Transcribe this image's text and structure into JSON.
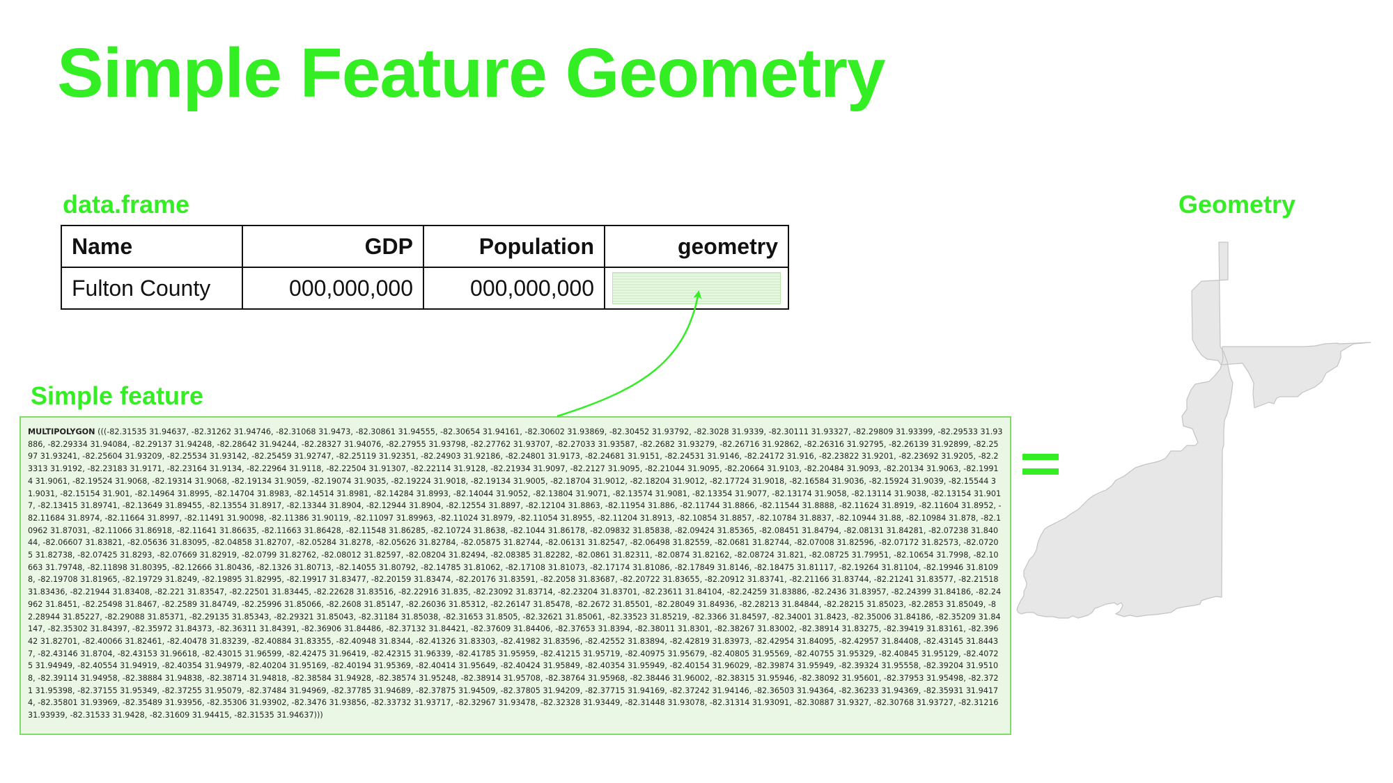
{
  "title": "Simple Feature Geometry",
  "dataframe": {
    "label": "data.frame",
    "headers": [
      "Name",
      "GDP",
      "Population",
      "geometry"
    ],
    "row": [
      "Fulton County",
      "000,000,000",
      "000,000,000"
    ]
  },
  "simple_feature": {
    "label": "Simple feature",
    "keyword": "MULTIPOLYGON",
    "text": " (((-82.31535 31.94637, -82.31262 31.94746, -82.31068 31.9473, -82.30861 31.94555, -82.30654 31.94161, -82.30602 31.93869, -82.30452 31.93792, -82.3028 31.9339, -82.30111 31.93327, -82.29809 31.93399, -82.29533 31.93886, -82.29334 31.94084, -82.29137 31.94248, -82.28642 31.94244, -82.28327 31.94076, -82.27955 31.93798, -82.27762 31.93707, -82.27033 31.93587, -82.2682 31.93279, -82.26716 31.92862, -82.26316 31.92795, -82.26139 31.92899, -82.2597 31.93241, -82.25604 31.93209, -82.25534 31.93142, -82.25459 31.92747, -82.25119 31.92351, -82.24903 31.92186, -82.24801 31.9173, -82.24681 31.9151, -82.24531 31.9146, -82.24172 31.916, -82.23822 31.9201, -82.23692 31.9205, -82.23313 31.9192, -82.23183 31.9171, -82.23164 31.9134, -82.22964 31.9118, -82.22504 31.91307, -82.22114 31.9128, -82.21934 31.9097, -82.2127 31.9095, -82.21044 31.9095, -82.20664 31.9103, -82.20484 31.9093, -82.20134 31.9063, -82.19914 31.9061, -82.19524 31.9068, -82.19314 31.9068, -82.19134 31.9059, -82.19074 31.9035, -82.19224 31.9018, -82.19134 31.9005, -82.18704 31.9012, -82.18204 31.9012, -82.17724 31.9018, -82.16584 31.9036, -82.15924 31.9039, -82.15544 31.9031, -82.15154 31.901, -82.14964 31.8995, -82.14704 31.8983, -82.14514 31.8981, -82.14284 31.8993, -82.14044 31.9052, -82.13804 31.9071, -82.13574 31.9081, -82.13354 31.9077, -82.13174 31.9058, -82.13114 31.9038, -82.13154 31.9017, -82.13415 31.89741, -82.13649 31.89455, -82.13554 31.8917, -82.13344 31.8904, -82.12944 31.8904, -82.12554 31.8897, -82.12104 31.8863, -82.11954 31.886, -82.11744 31.8866, -82.11544 31.8888, -82.11624 31.8919, -82.11604 31.8952, -82.11684 31.8974, -82.11664 31.8997, -82.11491 31.90098, -82.11386 31.90119, -82.11097 31.89963, -82.11024 31.8979, -82.11054 31.8955, -82.11204 31.8913, -82.10854 31.8857, -82.10784 31.8837, -82.10944 31.88, -82.10984 31.878, -82.10962 31.87031, -82.11066 31.86918, -82.11641 31.86635, -82.11663 31.86428, -82.11548 31.86285, -82.10724 31.8638, -82.1044 31.86178, -82.09832 31.85838, -82.09424 31.85365, -82.08451 31.84794, -82.08131 31.84281, -82.07238 31.84044, -82.06607 31.83821, -82.05636 31.83095, -82.04858 31.82707, -82.05284 31.8278, -82.05626 31.82784, -82.05875 31.82744, -82.06131 31.82547, -82.06498 31.82559, -82.0681 31.82744, -82.07008 31.82596, -82.07172 31.82573, -82.07205 31.82738, -82.07425 31.8293, -82.07669 31.82919, -82.0799 31.82762, -82.08012 31.82597, -82.08204 31.82494, -82.08385 31.82282, -82.0861 31.82311, -82.0874 31.82162, -82.08724 31.821, -82.08725 31.79951, -82.10654 31.7998, -82.10663 31.79748, -82.11898 31.80395, -82.12666 31.80436, -82.1326 31.80713, -82.14055 31.80792, -82.14785 31.81062, -82.17108 31.81073, -82.17174 31.81086, -82.17849 31.8146, -82.18475 31.81117, -82.19264 31.81104, -82.19946 31.81098, -82.19708 31.81965, -82.19729 31.8249, -82.19895 31.82995, -82.19917 31.83477, -82.20159 31.83474, -82.20176 31.83591, -82.2058 31.83687, -82.20722 31.83655, -82.20912 31.83741, -82.21166 31.83744, -82.21241 31.83577, -82.21518 31.83436, -82.21944 31.83408, -82.221 31.83547, -82.22501 31.83445, -82.22628 31.83516, -82.22916 31.835, -82.23092 31.83714, -82.23204 31.83701, -82.23611 31.84104, -82.24259 31.83886, -82.2436 31.83957, -82.24399 31.84186, -82.24962 31.8451, -82.25498 31.8467, -82.2589 31.84749, -82.25996 31.85066, -82.2608 31.85147, -82.26036 31.85312, -82.26147 31.85478, -82.2672 31.85501, -82.28049 31.84936, -82.28213 31.84844, -82.28215 31.85023, -82.2853 31.85049, -82.28944 31.85227, -82.29088 31.85371, -82.29135 31.85343, -82.29321 31.85043, -82.31184 31.85038, -82.31653 31.8505, -82.32621 31.85061, -82.33523 31.85219, -82.3366 31.84597, -82.34001 31.8423, -82.35006 31.84186, -82.35209 31.84147, -82.35302 31.84397, -82.35972 31.84373, -82.36311 31.84391, -82.36906 31.84486, -82.37132 31.84421, -82.37609 31.84406, -82.37653 31.8394, -82.38011 31.8301, -82.38267 31.83002, -82.38914 31.83275, -82.39419 31.83161, -82.39642 31.82701, -82.40066 31.82461, -82.40478 31.83239, -82.40884 31.83355, -82.40948 31.8344, -82.41326 31.83303, -82.41982 31.83596, -82.42552 31.83894, -82.42819 31.83973, -82.42954 31.84095, -82.42957 31.84408, -82.43145 31.84437, -82.43146 31.8704, -82.43153 31.96618, -82.43015 31.96599, -82.42475 31.96419, -82.42315 31.96339, -82.41785 31.95959, -82.41215 31.95719, -82.40975 31.95679, -82.40805 31.95569, -82.40755 31.95329, -82.40845 31.95129, -82.40725 31.94949, -82.40554 31.94919, -82.40354 31.94979, -82.40204 31.95169, -82.40194 31.95369, -82.40414 31.95649, -82.40424 31.95849, -82.40354 31.95949, -82.40154 31.96029, -82.39874 31.95949, -82.39324 31.95558, -82.39204 31.95108, -82.39114 31.94958, -82.38884 31.94838, -82.38714 31.94818, -82.38584 31.94928, -82.38574 31.95248, -82.38914 31.95708, -82.38764 31.95968, -82.38446 31.96002, -82.38315 31.95946, -82.38092 31.95601, -82.37953 31.95498, -82.3721 31.95398, -82.37155 31.95349, -82.37255 31.95079, -82.37484 31.94969, -82.37785 31.94689, -82.37875 31.94509, -82.37805 31.94209, -82.37715 31.94169, -82.37242 31.94146, -82.36503 31.94364, -82.36233 31.94369, -82.35931 31.94174, -82.35801 31.93969, -82.35489 31.93956, -82.35306 31.93902, -82.3476 31.93856, -82.33732 31.93717, -82.32967 31.93478, -82.32328 31.93449, -82.31448 31.93078, -82.31314 31.93091, -82.30887 31.9327, -82.30768 31.93727, -82.31216 31.93939, -82.31533 31.9428, -82.31609 31.94415, -82.31535 31.94637)))"
  },
  "geometry_label": "Geometry",
  "colors": {
    "accent": "#33ee22",
    "shape_fill": "#e6e7e6",
    "shape_stroke": "#c2c4c2",
    "box_fill": "#eaf7e4",
    "box_border": "#7fdc66"
  }
}
